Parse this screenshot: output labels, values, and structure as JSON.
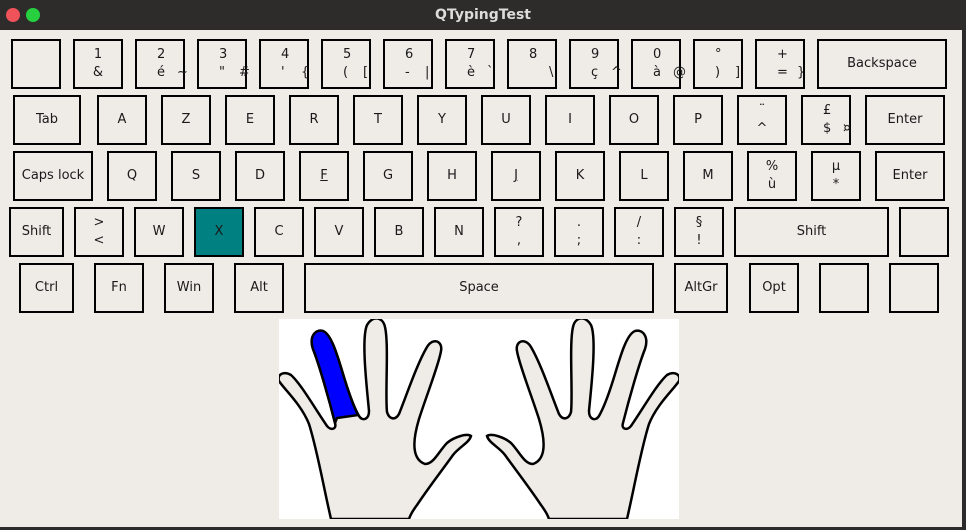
{
  "window": {
    "title": "QTypingTest",
    "close_icon": "close-circle-icon",
    "maximize_icon": "maximize-circle-icon"
  },
  "colors": {
    "active_key": "#008080",
    "active_finger": "#0000ff",
    "background": "#efebe7"
  },
  "keyboard": {
    "active_key": "X",
    "rows": [
      [
        {
          "id": "grave",
          "top": "",
          "bottom": "",
          "alt": ""
        },
        {
          "id": "1",
          "top": "1",
          "bottom": "&",
          "alt": "",
          "centered": true
        },
        {
          "id": "2",
          "top": "2",
          "bottom": "é",
          "alt": "~"
        },
        {
          "id": "3",
          "top": "3",
          "bottom": "\"",
          "alt": "#"
        },
        {
          "id": "4",
          "top": "4",
          "bottom": "'",
          "alt": "{"
        },
        {
          "id": "5",
          "top": "5",
          "bottom": "(",
          "alt": "["
        },
        {
          "id": "6",
          "top": "6",
          "bottom": "-",
          "alt": "|"
        },
        {
          "id": "7",
          "top": "7",
          "bottom": "è",
          "alt": "`"
        },
        {
          "id": "8",
          "top": "8",
          "bottom": "",
          "alt": "\\"
        },
        {
          "id": "9",
          "top": "9",
          "bottom": "ç",
          "alt": "^"
        },
        {
          "id": "0",
          "top": "0",
          "bottom": "à",
          "alt": "@"
        },
        {
          "id": "degree",
          "top": "°",
          "bottom": ")",
          "alt": "]"
        },
        {
          "id": "plus",
          "top": "+",
          "bottom": "=",
          "alt": "}"
        },
        {
          "id": "backspace",
          "label": "Backspace"
        }
      ],
      [
        {
          "id": "tab",
          "label": "Tab"
        },
        {
          "id": "a",
          "label": "A"
        },
        {
          "id": "z",
          "label": "Z"
        },
        {
          "id": "e",
          "label": "E"
        },
        {
          "id": "r",
          "label": "R"
        },
        {
          "id": "t",
          "label": "T"
        },
        {
          "id": "y",
          "label": "Y"
        },
        {
          "id": "u",
          "label": "U"
        },
        {
          "id": "i",
          "label": "I"
        },
        {
          "id": "o",
          "label": "O"
        },
        {
          "id": "p",
          "label": "P"
        },
        {
          "id": "circumflex",
          "top": "¨",
          "bottom": "^",
          "centered": true
        },
        {
          "id": "pound",
          "top": "£",
          "bottom": "$",
          "alt": "¤"
        },
        {
          "id": "enter-top",
          "label": "Enter"
        }
      ],
      [
        {
          "id": "capslock",
          "label": "Caps lock"
        },
        {
          "id": "q",
          "label": "Q"
        },
        {
          "id": "s",
          "label": "S"
        },
        {
          "id": "d",
          "label": "D"
        },
        {
          "id": "f",
          "label": "F",
          "underline": true
        },
        {
          "id": "g",
          "label": "G"
        },
        {
          "id": "h",
          "label": "H"
        },
        {
          "id": "j",
          "label": "J",
          "underline": true
        },
        {
          "id": "k",
          "label": "K"
        },
        {
          "id": "l",
          "label": "L"
        },
        {
          "id": "m",
          "label": "M"
        },
        {
          "id": "percent",
          "top": "%",
          "bottom": "ù",
          "centered": true
        },
        {
          "id": "mu",
          "top": "µ",
          "bottom": "*",
          "centered": true
        },
        {
          "id": "enter-bottom",
          "label": "Enter"
        }
      ],
      [
        {
          "id": "shift-left",
          "label": "Shift"
        },
        {
          "id": "angle",
          "top": ">",
          "bottom": "<",
          "centered": true
        },
        {
          "id": "w",
          "label": "W"
        },
        {
          "id": "x",
          "label": "X"
        },
        {
          "id": "c",
          "label": "C"
        },
        {
          "id": "v",
          "label": "V"
        },
        {
          "id": "b",
          "label": "B"
        },
        {
          "id": "n",
          "label": "N"
        },
        {
          "id": "question",
          "top": "?",
          "bottom": ",",
          "centered": true
        },
        {
          "id": "period",
          "top": ".",
          "bottom": ";",
          "centered": true
        },
        {
          "id": "slash",
          "top": "/",
          "bottom": ":",
          "centered": true
        },
        {
          "id": "section",
          "top": "§",
          "bottom": "!",
          "centered": true
        },
        {
          "id": "shift-right",
          "label": "Shift"
        },
        {
          "id": "extra-right",
          "label": ""
        }
      ],
      [
        {
          "id": "ctrl",
          "label": "Ctrl"
        },
        {
          "id": "fn",
          "label": "Fn"
        },
        {
          "id": "win",
          "label": "Win"
        },
        {
          "id": "alt",
          "label": "Alt"
        },
        {
          "id": "space",
          "label": "Space"
        },
        {
          "id": "altgr",
          "label": "AltGr"
        },
        {
          "id": "opt",
          "label": "Opt"
        },
        {
          "id": "blank-1",
          "label": ""
        },
        {
          "id": "blank-2",
          "label": ""
        }
      ]
    ]
  },
  "hands": {
    "highlighted_finger": "left-ring-finger",
    "left_hand_label": "left-hand",
    "right_hand_label": "right-hand"
  }
}
